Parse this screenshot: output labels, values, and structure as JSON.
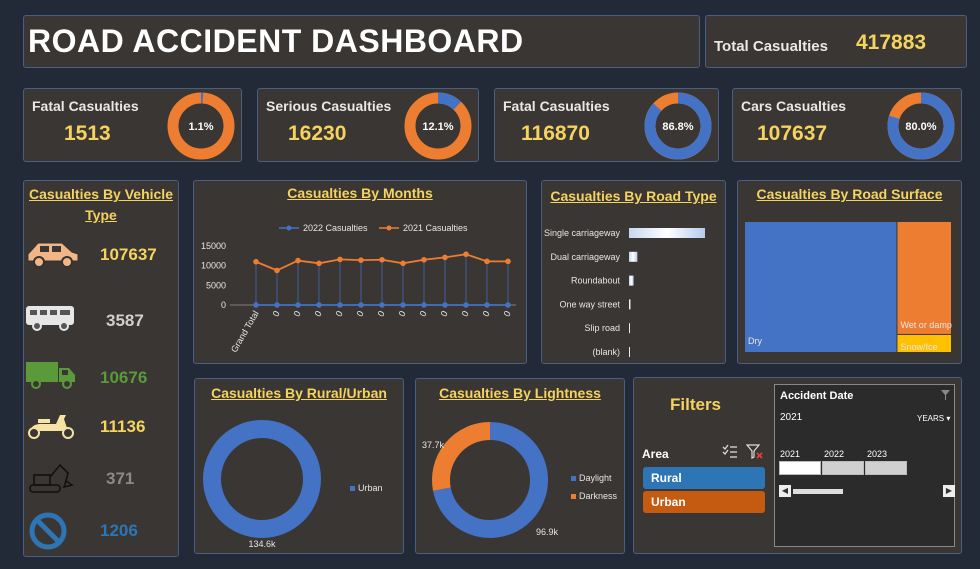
{
  "header": {
    "title": "ROAD ACCIDENT DASHBOARD",
    "total_label": "Total Casualties",
    "total_value": "417883"
  },
  "kpis": [
    {
      "label": "Fatal Casualties",
      "value": "1513",
      "pct_label": "1.1%",
      "pct": 1.1
    },
    {
      "label": "Serious Casualties",
      "value": "16230",
      "pct_label": "12.1%",
      "pct": 12.1
    },
    {
      "label": "Fatal Casualties",
      "value": "116870",
      "pct_label": "86.8%",
      "pct": 86.8
    },
    {
      "label": "Cars Casualties",
      "value": "107637",
      "pct_label": "80.0%",
      "pct": 80.0
    }
  ],
  "vehicle": {
    "title_line1": "Casualties By Vehicle",
    "title_line2": "Type",
    "items": [
      {
        "icon": "car-icon",
        "value": "107637",
        "color": "#f4d35e"
      },
      {
        "icon": "bus-icon",
        "value": "3587",
        "color": "#d0d0d0"
      },
      {
        "icon": "truck-icon",
        "value": "10676",
        "color": "#5a9a3a"
      },
      {
        "icon": "scooter-icon",
        "value": "11136",
        "color": "#f4d35e"
      },
      {
        "icon": "excavator-icon",
        "value": "371",
        "color": "#8a8a8a"
      },
      {
        "icon": "no-entry-icon",
        "value": "1206",
        "color": "#2e75b6"
      }
    ]
  },
  "months_chart": {
    "title": "Casualties By Months",
    "legend": [
      "2022 Casualties",
      "2021 Casualties"
    ],
    "y_ticks": [
      "15000",
      "10000",
      "5000",
      "0"
    ],
    "x_labels": [
      "Grand Total",
      "0",
      "0",
      "0",
      "0",
      "0",
      "0",
      "0",
      "0",
      "0",
      "0",
      "0",
      "0"
    ]
  },
  "road_type": {
    "title": "Casualties By Road Type",
    "categories": [
      "Single carriageway",
      "Dual carriageway",
      "Roundabout",
      "One way street",
      "Slip road",
      "(blank)"
    ]
  },
  "road_surface": {
    "title": "Casualties By Road Surface",
    "labels": [
      "Dry",
      "Wet or damp",
      "Snow/Ice"
    ]
  },
  "rural_urban": {
    "title": "Casualties By Rural/Urban",
    "legend": [
      "Urban"
    ],
    "value_label": "134.6k"
  },
  "lightness": {
    "title": "Casualties By Lightness",
    "legend": [
      "Daylight",
      "Darkness"
    ],
    "labels": [
      "37.7k",
      "96.9k"
    ]
  },
  "filters": {
    "title": "Filters",
    "area_label": "Area",
    "options": [
      "Rural",
      "Urban"
    ],
    "timeline": {
      "title": "Accident Date",
      "selected": "2021",
      "unit": "YEARS",
      "years": [
        "2021",
        "2022",
        "2023"
      ]
    }
  },
  "chart_data": [
    {
      "type": "line",
      "title": "Casualties By Months",
      "x": [
        "Grand Total",
        "0",
        "0",
        "0",
        "0",
        "0",
        "0",
        "0",
        "0",
        "0",
        "0",
        "0",
        "0"
      ],
      "series": [
        {
          "name": "2022 Casualties",
          "values": [
            0,
            0,
            0,
            0,
            0,
            0,
            0,
            0,
            0,
            0,
            0,
            0,
            0
          ]
        },
        {
          "name": "2021 Casualties",
          "values": [
            11000,
            8800,
            11300,
            10600,
            11600,
            11400,
            11500,
            10600,
            11500,
            12100,
            12900,
            11100,
            11100
          ]
        }
      ],
      "ylim": [
        0,
        15000
      ],
      "colors": [
        "#4472c4",
        "#ed7d31"
      ]
    },
    {
      "type": "bar",
      "title": "Casualties By Road Type",
      "categories": [
        "Single carriageway",
        "Dual carriageway",
        "Roundabout",
        "One way street",
        "Slip road",
        "(blank)"
      ],
      "values": [
        100,
        11,
        6,
        2,
        1,
        0.5
      ]
    },
    {
      "type": "heatmap",
      "title": "Casualties By Road Surface",
      "categories": [
        "Dry",
        "Wet or damp",
        "Snow/Ice"
      ],
      "values": [
        100,
        31,
        5
      ],
      "colors": [
        "#4472c4",
        "#ed7d31",
        "#ffc000"
      ]
    },
    {
      "type": "pie",
      "title": "Casualties By Rural/Urban",
      "categories": [
        "Urban"
      ],
      "values": [
        134.6
      ],
      "colors": [
        "#4472c4"
      ]
    },
    {
      "type": "pie",
      "title": "Casualties By Lightness",
      "categories": [
        "Daylight",
        "Darkness"
      ],
      "values": [
        96.9,
        37.7
      ],
      "colors": [
        "#4472c4",
        "#ed7d31"
      ]
    }
  ],
  "colors": {
    "accent": "#f4d35e",
    "blue": "#4472c4",
    "orange": "#ed7d31",
    "panel": "#3a3633",
    "bg": "#222a38"
  }
}
